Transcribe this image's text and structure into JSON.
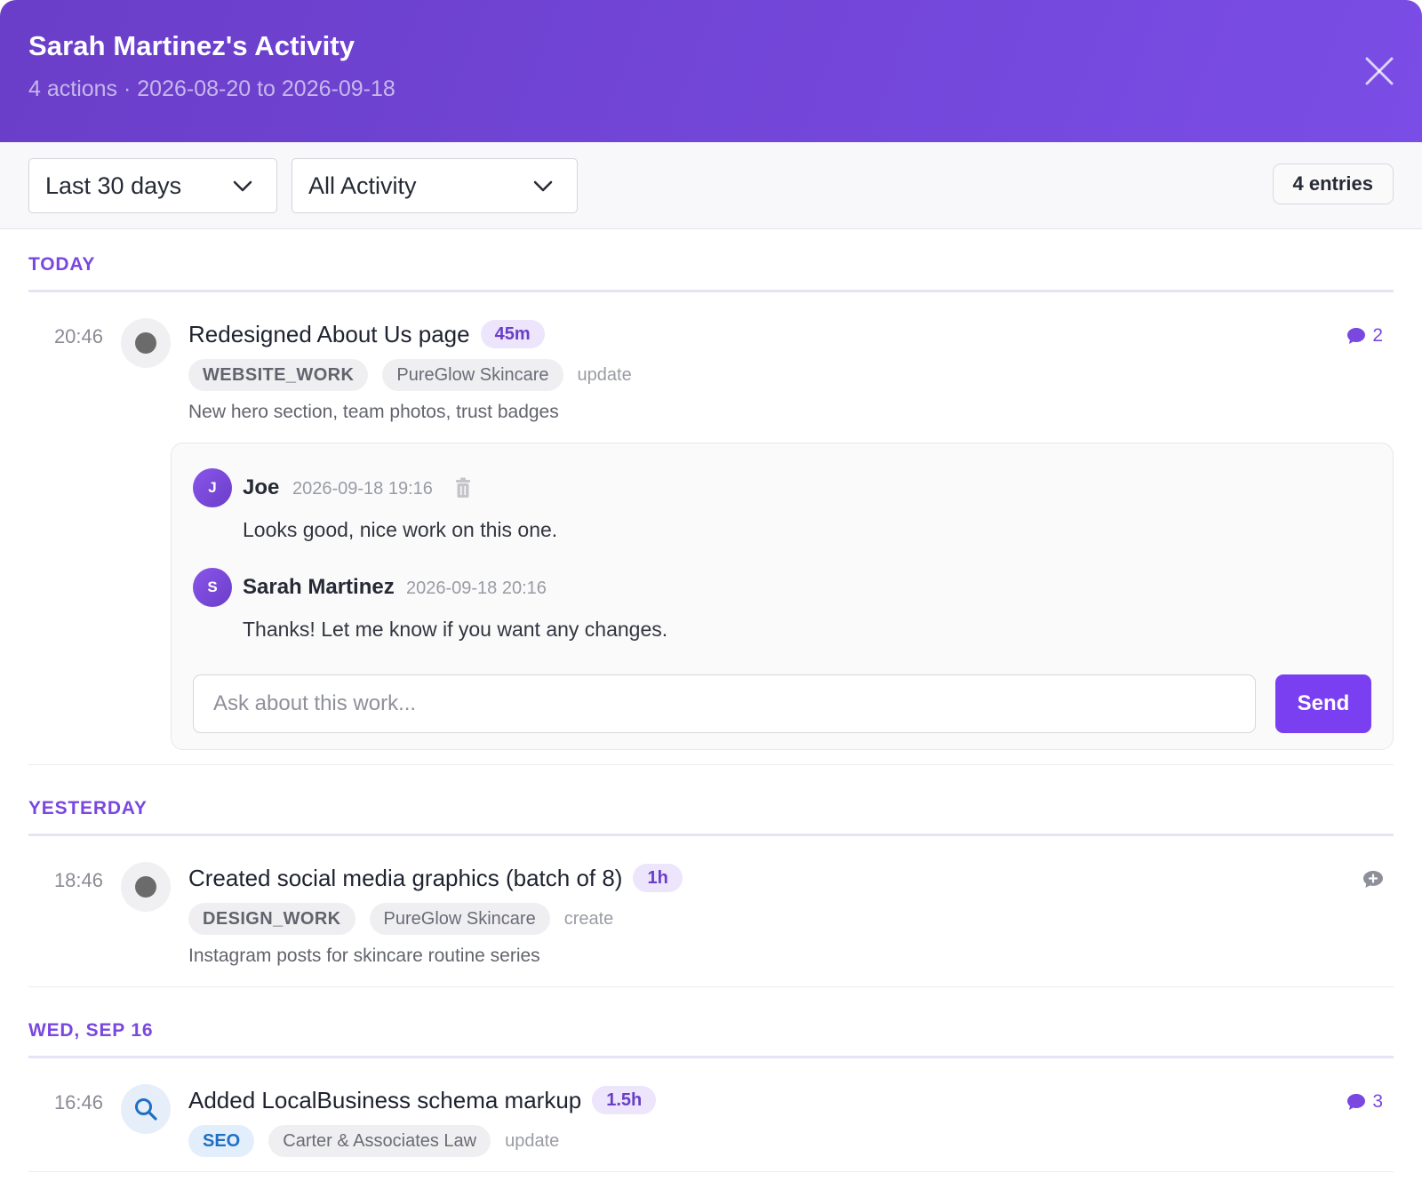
{
  "header": {
    "title": "Sarah Martinez's Activity",
    "subtitle": "4 actions · 2026-08-20 to 2026-09-18"
  },
  "toolbar": {
    "range_select": "Last 30 days",
    "activity_select": "All Activity",
    "entries_count": "4 entries"
  },
  "groups": [
    {
      "label": "TODAY",
      "entries": [
        {
          "time": "20:46",
          "icon": "gray-dot-icon",
          "title": "Redesigned About Us page",
          "duration": "45m",
          "type": "WEBSITE_WORK",
          "client": "PureGlow Skincare",
          "verb": "update",
          "description": "New hero section, team photos, trust badges",
          "comment_count": "2",
          "comments": [
            {
              "initial": "J",
              "author": "Joe",
              "time": "2026-09-18 19:16",
              "text": "Looks good, nice work on this one."
            },
            {
              "initial": "S",
              "author": "Sarah Martinez",
              "time": "2026-09-18 20:16",
              "text": "Thanks! Let me know if you want any changes."
            }
          ],
          "comment_input_placeholder": "Ask about this work...",
          "send_label": "Send"
        }
      ]
    },
    {
      "label": "YESTERDAY",
      "entries": [
        {
          "time": "18:46",
          "icon": "gray-dot-icon",
          "title": "Created social media graphics (batch of 8)",
          "duration": "1h",
          "type": "DESIGN_WORK",
          "client": "PureGlow Skincare",
          "verb": "create",
          "description": "Instagram posts for skincare routine series"
        }
      ]
    },
    {
      "label": "WED, SEP 16",
      "entries": [
        {
          "time": "16:46",
          "icon": "search-icon",
          "title": "Added LocalBusiness schema markup",
          "duration": "1.5h",
          "type": "SEO",
          "client": "Carter & Associates Law",
          "verb": "update",
          "comment_count": "3"
        }
      ]
    }
  ],
  "colors": {
    "accent": "#7a47e0",
    "header_start": "#6a3ec8",
    "header_end": "#7a4de6",
    "send_button": "#7a3ff0"
  }
}
